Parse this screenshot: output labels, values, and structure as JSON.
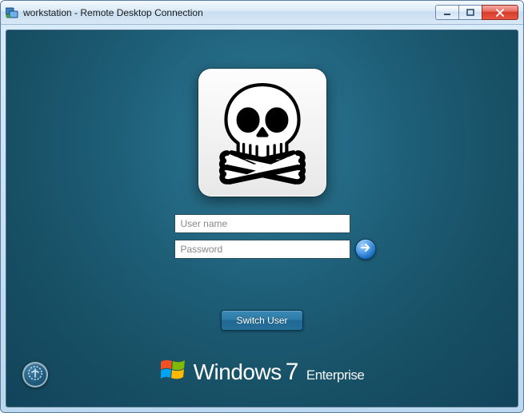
{
  "window": {
    "title": "workstation - Remote Desktop Connection"
  },
  "login": {
    "username_placeholder": "User name",
    "username_value": "",
    "password_placeholder": "Password",
    "password_value": "",
    "switch_user_label": "Switch User"
  },
  "branding": {
    "product": "Windows",
    "version": "7",
    "edition": "Enterprise"
  },
  "icons": {
    "app": "rdc-icon",
    "avatar": "skull-crossbones-icon",
    "submit": "arrow-right-icon",
    "ease": "ease-of-access-icon",
    "logo": "windows-logo-icon"
  },
  "colors": {
    "desktop_bg": "#1e5f78",
    "accent": "#2c7aa8",
    "close": "#d43d2a"
  }
}
